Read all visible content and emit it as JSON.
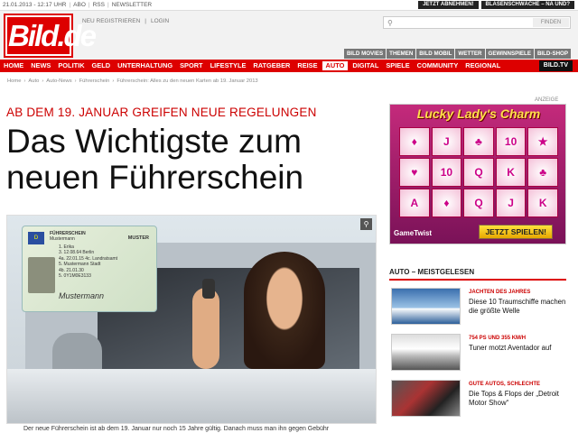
{
  "topbar": {
    "date": "21.01.2013 - 12:17 UHR",
    "links": [
      "ABO",
      "RSS",
      "NEWSLETTER"
    ],
    "right_buttons": [
      "JETZT ABNEHMEN!",
      "BLASENSCHWÄCHE – NA UND?"
    ]
  },
  "header": {
    "logo_text": "Bild.de",
    "register": "NEU REGISTRIEREN",
    "login": "LOGIN",
    "search_button": "FINDEN",
    "search_icon": "search-icon",
    "subnav": [
      "BILD MOVIES",
      "THEMEN",
      "BILD MOBIL",
      "WETTER",
      "GEWINNSPIELE",
      "BILD-SHOP"
    ]
  },
  "nav": {
    "items": [
      "HOME",
      "NEWS",
      "POLITIK",
      "GELD",
      "UNTERHALTUNG",
      "SPORT",
      "LIFESTYLE",
      "RATGEBER",
      "REISE",
      "AUTO",
      "DIGITAL",
      "SPIELE",
      "COMMUNITY",
      "REGIONAL"
    ],
    "active": "AUTO",
    "tv": "BILD.TV",
    "accent": "#dd0000"
  },
  "breadcrumb": [
    "Home",
    "Auto",
    "Auto-News",
    "Führerschein",
    "Führerschein: Alles zu den neuen Karten ab 19. Januar 2013"
  ],
  "article": {
    "kicker": "AB DEM 19. JANUAR GREIFEN NEUE REGELUNGEN",
    "headline": "Das Wichtigste zum neuen Führerschein",
    "zoom_icon": "zoom-icon",
    "license": {
      "label1": "FÜHRERSCHEIN",
      "label2": "Mustermann",
      "muster": "MUSTER",
      "lines": [
        "1. Erika",
        "3. 12.08.64 Berlin",
        "4a. 22.01.15 4c. Landratsamt",
        "5. Mustermann Stadt",
        "4b. 21.01.30",
        "5. 0Y1M0E3133"
      ],
      "signature": "Mustermann"
    },
    "caption": "Der neue Führerschein ist ab dem 19. Januar nur noch 15 Jahre gültig. Danach muss man ihn gegen Gebühr"
  },
  "ad": {
    "label": "ANZEIGE",
    "title": "Lucky Lady's Charm",
    "reels": [
      "♦",
      "J",
      "♣",
      "10",
      "★",
      "♥",
      "10",
      "Q",
      "K",
      "♣",
      "A",
      "♦",
      "Q",
      "J",
      "K"
    ],
    "brand": "GameTwist",
    "cta": "JETZT SPIELEN!"
  },
  "sidebar": {
    "heading": "AUTO – MEISTGELESEN",
    "items": [
      {
        "kicker": "JACHTEN DES JAHRES",
        "title": "Diese 10 Traumschiffe machen die größte Welle"
      },
      {
        "kicker": "754 PS UND 355 KM/H",
        "title": "Tuner motzt Aventador auf"
      },
      {
        "kicker": "GUTE AUTOS, SCHLECHTE",
        "title": "Die Tops & Flops der „Detroit Motor Show“"
      }
    ]
  }
}
